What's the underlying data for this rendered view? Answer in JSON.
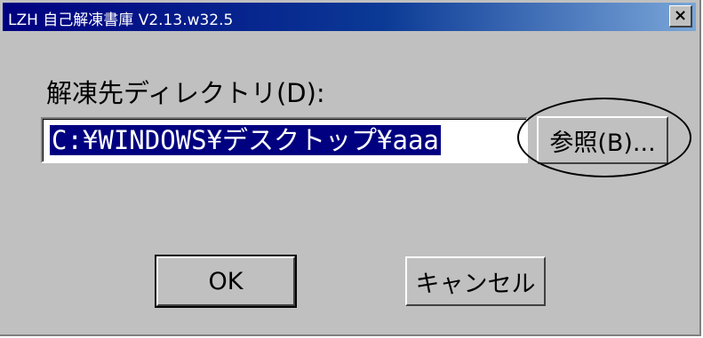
{
  "window": {
    "title": "LZH 自己解凍書庫 V2.13.w32.5",
    "close_symbol": "×"
  },
  "form": {
    "destination_label": "解凍先ディレクトリ(D):",
    "destination_value": "C:¥WINDOWS¥デスクトップ¥aaa"
  },
  "buttons": {
    "browse_label": "参照(B)...",
    "ok_label": "OK",
    "cancel_label": "キャンセル"
  },
  "colors": {
    "titlebar_start": "#000080",
    "titlebar_end": "#7aa6d8",
    "dialog_bg": "#c0c0c0",
    "selection_bg": "#000080"
  }
}
